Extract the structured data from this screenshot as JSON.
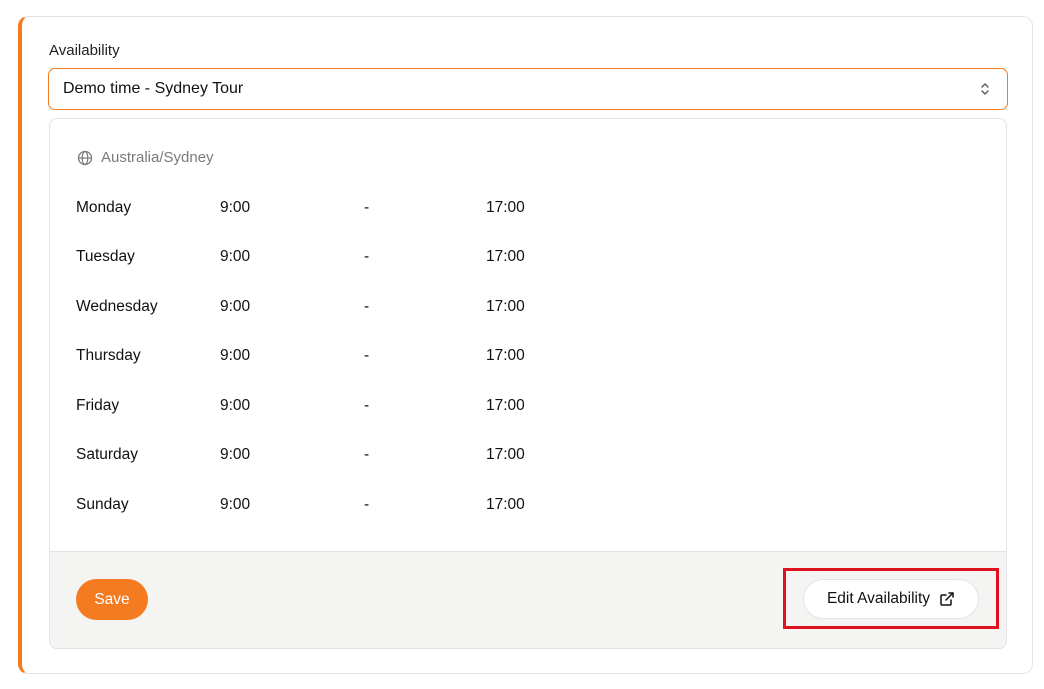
{
  "availability": {
    "label": "Availability",
    "selected_schedule": "Demo time - Sydney Tour"
  },
  "schedule": {
    "timezone": "Australia/Sydney",
    "separator": "-",
    "days": [
      {
        "day": "Monday",
        "start": "9:00",
        "end": "17:00"
      },
      {
        "day": "Tuesday",
        "start": "9:00",
        "end": "17:00"
      },
      {
        "day": "Wednesday",
        "start": "9:00",
        "end": "17:00"
      },
      {
        "day": "Thursday",
        "start": "9:00",
        "end": "17:00"
      },
      {
        "day": "Friday",
        "start": "9:00",
        "end": "17:00"
      },
      {
        "day": "Saturday",
        "start": "9:00",
        "end": "17:00"
      },
      {
        "day": "Sunday",
        "start": "9:00",
        "end": "17:00"
      }
    ]
  },
  "actions": {
    "save_label": "Save",
    "edit_label": "Edit Availability"
  },
  "icons": {
    "timezone": "globe-icon",
    "select": "chevron-up-down-icon",
    "edit": "external-link-icon"
  },
  "colors": {
    "accent": "#f47b20",
    "highlight": "#e0121f"
  }
}
